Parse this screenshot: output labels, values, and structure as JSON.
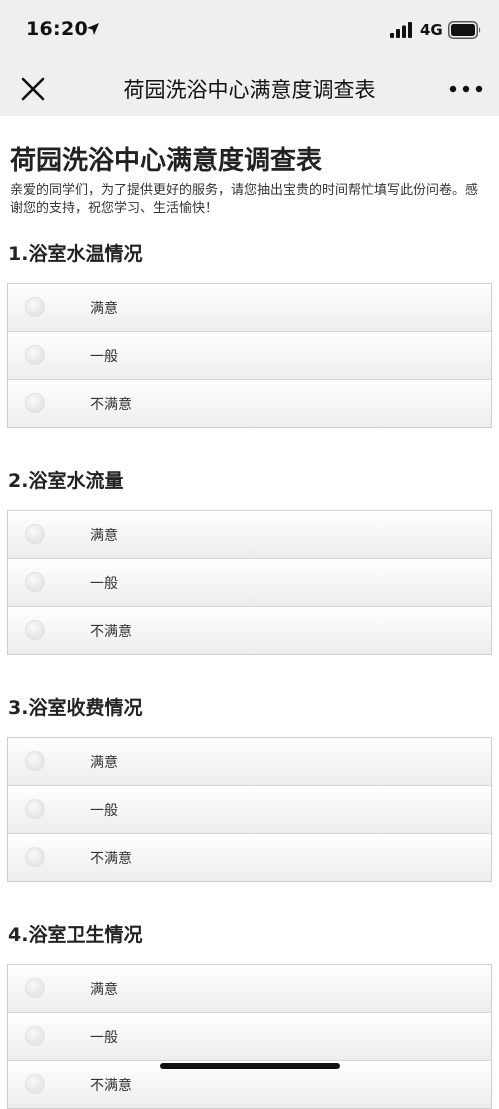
{
  "status_bar": {
    "time": "16:20",
    "network": "4G",
    "icons": [
      "location-arrow-icon",
      "signal-bars-icon",
      "battery-icon"
    ]
  },
  "nav": {
    "title": "荷园洗浴中心满意度调查表",
    "close_icon": "close-icon",
    "more_icon": "more-icon"
  },
  "survey": {
    "title": "荷园洗浴中心满意度调查表",
    "description": "亲爱的同学们，为了提供更好的服务，请您抽出宝贵的时间帮忙填写此份问卷。感谢您的支持，祝您学习、生活愉快！"
  },
  "questions": [
    {
      "title": "1.浴室水温情况",
      "options": [
        {
          "label": "满意"
        },
        {
          "label": "一般"
        },
        {
          "label": "不满意"
        }
      ]
    },
    {
      "title": "2.浴室水流量",
      "options": [
        {
          "label": "满意"
        },
        {
          "label": "一般"
        },
        {
          "label": "不满意"
        }
      ]
    },
    {
      "title": "3.浴室收费情况",
      "options": [
        {
          "label": "满意"
        },
        {
          "label": "一般"
        },
        {
          "label": "不满意"
        }
      ]
    },
    {
      "title": "4.浴室卫生情况",
      "options": [
        {
          "label": "满意"
        },
        {
          "label": "一般"
        },
        {
          "label": "不满意"
        }
      ]
    }
  ]
}
